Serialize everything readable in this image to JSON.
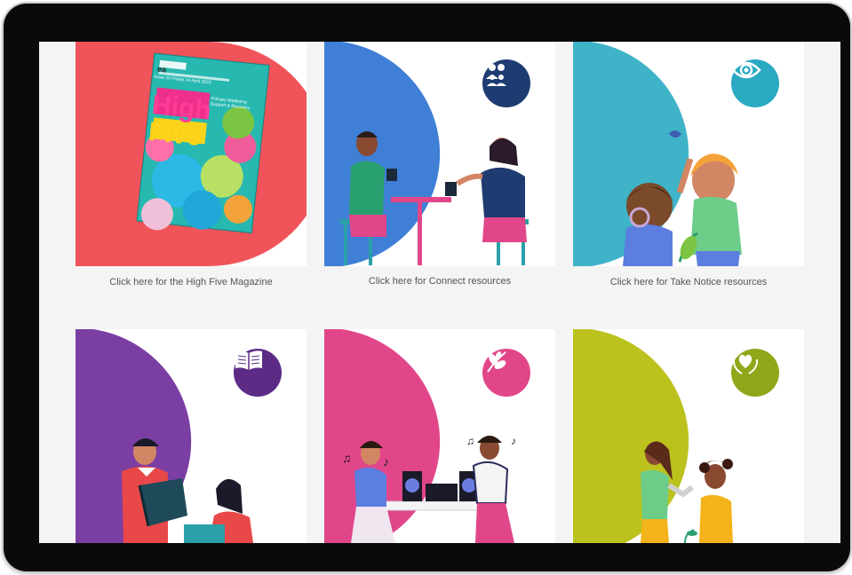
{
  "magazine": {
    "brand": "ea",
    "issue_line": "Issue 10 Friday 14 April 2023",
    "headline_1": "High",
    "headline_2": "Five",
    "subhead": "Primary Wellbeing Support & Recovery"
  },
  "cards": [
    {
      "caption": "Click here for the High Five Magazine",
      "color": "#f0545a",
      "icon": "magazine-cover"
    },
    {
      "caption": "Click here for Connect resources",
      "color": "#3f7fd6",
      "icon": "people-icon",
      "badge_color": "#1e3c72"
    },
    {
      "caption": "Click here for Take Notice resources",
      "color": "#3fb3c8",
      "icon": "eye-icon",
      "badge_color": "#2aa9c3"
    },
    {
      "caption": "",
      "color": "#7b3fa4",
      "icon": "book-icon",
      "badge_color": "#5b2b86"
    },
    {
      "caption": "",
      "color": "#e1468a",
      "icon": "leaf-icon",
      "badge_color": "#e1468a"
    },
    {
      "caption": "",
      "color": "#bcc21d",
      "icon": "heart-hands-icon",
      "badge_color": "#8fa81a"
    }
  ],
  "colors": {
    "frame": "#0a0a0a",
    "screen_bg": "#f4f4f4",
    "card_bg": "#ffffff",
    "caption_text": "#555555"
  }
}
